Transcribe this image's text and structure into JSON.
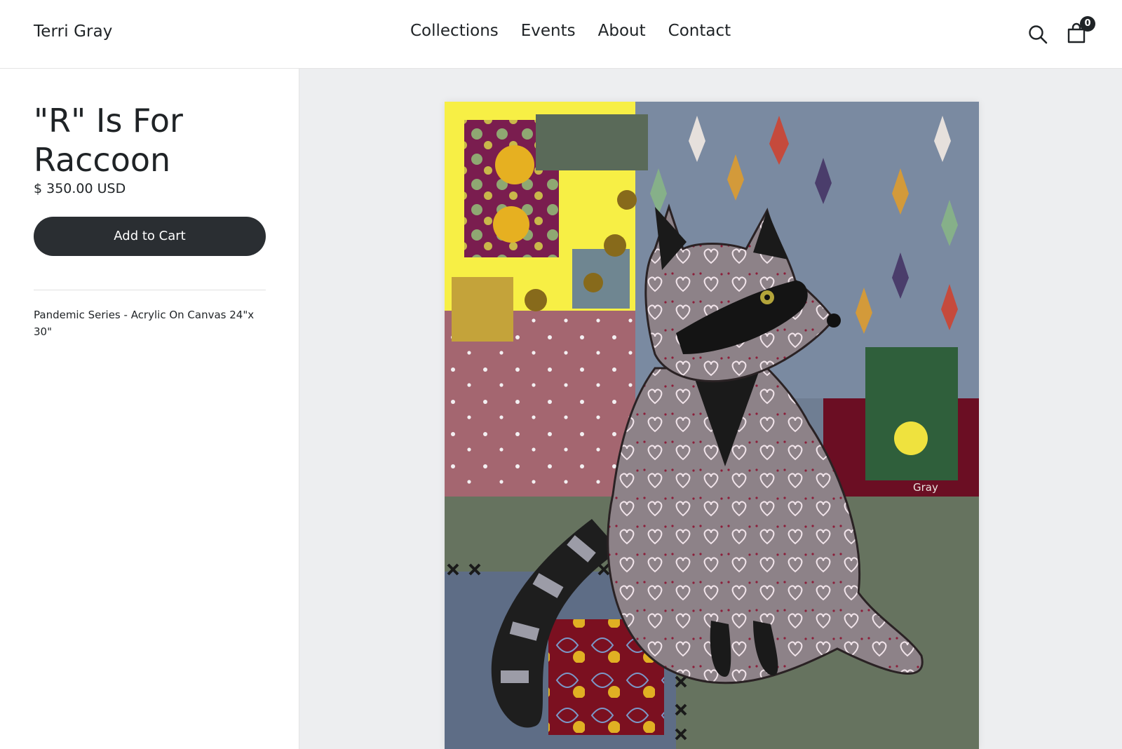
{
  "header": {
    "brand": "Terri Gray",
    "nav": [
      "Collections",
      "Events",
      "About",
      "Contact"
    ],
    "cart_count": "0",
    "search_icon": "search-icon",
    "cart_icon": "shopping-bag-icon"
  },
  "product": {
    "title": "\"R\" Is For Raccoon",
    "price": "$ 350.00 USD",
    "add_to_cart": "Add to Cart",
    "description": "Pandemic Series - Acrylic On Canvas 24\"x 30\""
  },
  "artwork": {
    "signature": "Gray"
  },
  "colors": {
    "text": "#1f2326",
    "button_bg": "#2a2e32",
    "gallery_bg": "#edeef0"
  }
}
